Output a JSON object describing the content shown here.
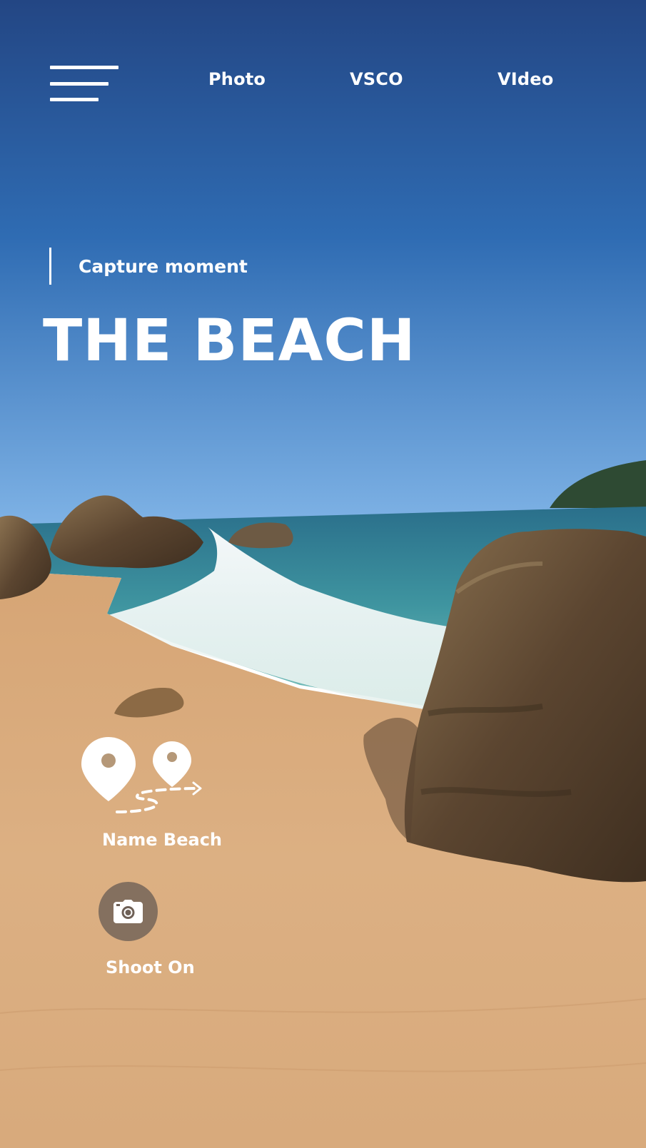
{
  "nav": {
    "menu_icon": "hamburger-menu-icon",
    "tabs": [
      {
        "label": "Photo"
      },
      {
        "label": "VSCO"
      },
      {
        "label": "VIdeo"
      }
    ]
  },
  "hero": {
    "eyebrow": "Capture moment",
    "title": "THE BEACH"
  },
  "location": {
    "icon": "map-route-icon",
    "label": "Name Beach"
  },
  "shoot": {
    "icon": "camera-icon",
    "label": "Shoot On"
  },
  "colors": {
    "text": "#ffffff",
    "sky_top": "#244c8c",
    "sky_horizon": "#74a8de",
    "sea": "#3f8f9d",
    "sand": "#d9ac7a",
    "rock": "#6b5439",
    "shoot_button_bg": "#6e6056"
  }
}
